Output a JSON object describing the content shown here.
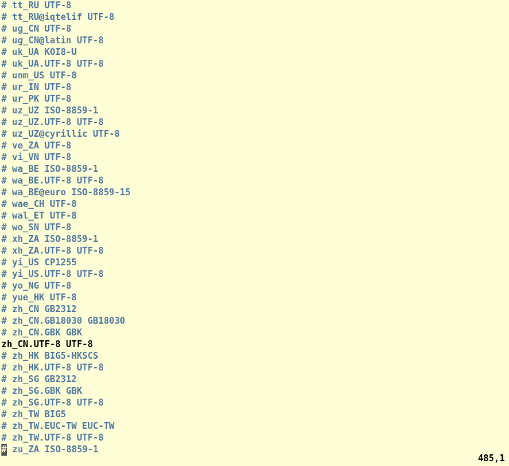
{
  "lines": [
    {
      "text": "# tt_RU UTF-8",
      "commented": true
    },
    {
      "text": "# tt_RU@iqtelif UTF-8",
      "commented": true
    },
    {
      "text": "# ug_CN UTF-8",
      "commented": true
    },
    {
      "text": "# ug_CN@latin UTF-8",
      "commented": true
    },
    {
      "text": "# uk_UA KOI8-U",
      "commented": true
    },
    {
      "text": "# uk_UA.UTF-8 UTF-8",
      "commented": true
    },
    {
      "text": "# unm_US UTF-8",
      "commented": true
    },
    {
      "text": "# ur_IN UTF-8",
      "commented": true
    },
    {
      "text": "# ur_PK UTF-8",
      "commented": true
    },
    {
      "text": "# uz_UZ ISO-8859-1",
      "commented": true
    },
    {
      "text": "# uz_UZ.UTF-8 UTF-8",
      "commented": true
    },
    {
      "text": "# uz_UZ@cyrillic UTF-8",
      "commented": true
    },
    {
      "text": "# ve_ZA UTF-8",
      "commented": true
    },
    {
      "text": "# vi_VN UTF-8",
      "commented": true
    },
    {
      "text": "# wa_BE ISO-8859-1",
      "commented": true
    },
    {
      "text": "# wa_BE.UTF-8 UTF-8",
      "commented": true
    },
    {
      "text": "# wa_BE@euro ISO-8859-15",
      "commented": true
    },
    {
      "text": "# wae_CH UTF-8",
      "commented": true
    },
    {
      "text": "# wal_ET UTF-8",
      "commented": true
    },
    {
      "text": "# wo_SN UTF-8",
      "commented": true
    },
    {
      "text": "# xh_ZA ISO-8859-1",
      "commented": true
    },
    {
      "text": "# xh_ZA.UTF-8 UTF-8",
      "commented": true
    },
    {
      "text": "# yi_US CP1255",
      "commented": true
    },
    {
      "text": "# yi_US.UTF-8 UTF-8",
      "commented": true
    },
    {
      "text": "# yo_NG UTF-8",
      "commented": true
    },
    {
      "text": "# yue_HK UTF-8",
      "commented": true
    },
    {
      "text": "# zh_CN GB2312",
      "commented": true
    },
    {
      "text": "# zh_CN.GB18030 GB18030",
      "commented": true
    },
    {
      "text": "# zh_CN.GBK GBK",
      "commented": true
    },
    {
      "text": "zh_CN.UTF-8 UTF-8",
      "commented": false
    },
    {
      "text": "# zh_HK BIG5-HKSCS",
      "commented": true
    },
    {
      "text": "# zh_HK.UTF-8 UTF-8",
      "commented": true
    },
    {
      "text": "# zh_SG GB2312",
      "commented": true
    },
    {
      "text": "# zh_SG.GBK GBK",
      "commented": true
    },
    {
      "text": "# zh_SG.UTF-8 UTF-8",
      "commented": true
    },
    {
      "text": "# zh_TW BIG5",
      "commented": true
    },
    {
      "text": "# zh_TW.EUC-TW EUC-TW",
      "commented": true
    },
    {
      "text": "# zh_TW.UTF-8 UTF-8",
      "commented": true
    },
    {
      "text": "# zu_ZA ISO-8859-1",
      "commented": true
    }
  ],
  "cursor_line_index": 38,
  "status": "485,1"
}
